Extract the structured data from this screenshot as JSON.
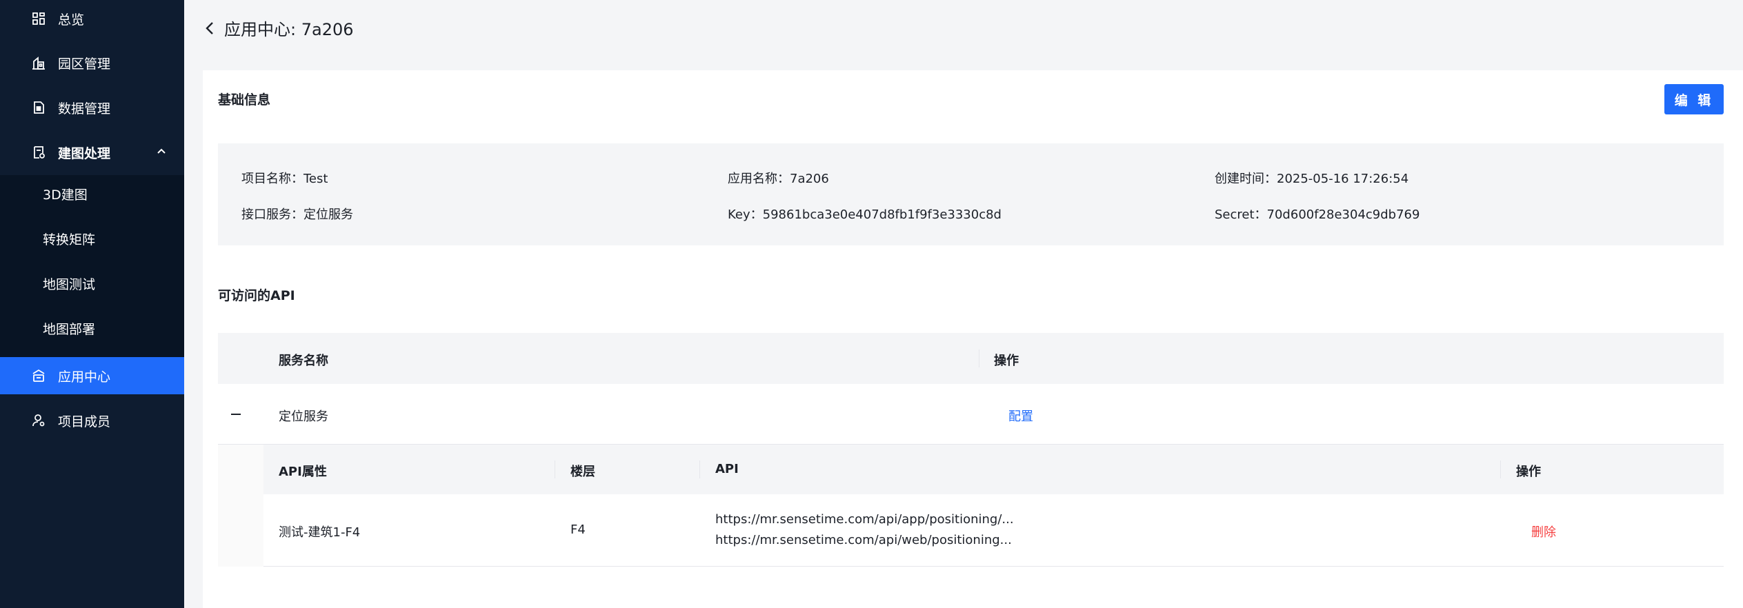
{
  "sidebar": {
    "items": [
      {
        "label": "总览",
        "icon": "dashboard-icon"
      },
      {
        "label": "园区管理",
        "icon": "building-icon"
      },
      {
        "label": "数据管理",
        "icon": "file-icon"
      },
      {
        "label": "建图处理",
        "icon": "map-process-icon",
        "expanded": true
      },
      {
        "label": "应用中心",
        "icon": "app-center-icon",
        "active": true
      },
      {
        "label": "项目成员",
        "icon": "member-icon"
      }
    ],
    "submenu": [
      {
        "label": "3D建图"
      },
      {
        "label": "转换矩阵"
      },
      {
        "label": "地图测试"
      },
      {
        "label": "地图部署"
      }
    ]
  },
  "header": {
    "title": "应用中心: 7a206"
  },
  "basic_info": {
    "title": "基础信息",
    "edit_label": "编 辑",
    "project_name": "项目名称：Test",
    "app_name": "应用名称：7a206",
    "created_time": "创建时间：2025-05-16 17:26:54",
    "api_service": "接口服务：定位服务",
    "key": "Key：59861bca3e0e407d8fb1f9f3e3330c8d",
    "secret": "Secret：70d600f28e304c9db769"
  },
  "api_section": {
    "title": "可访问的API",
    "columns": [
      "服务名称",
      "操作"
    ],
    "rows": [
      {
        "service": "定位服务",
        "action": "配置"
      }
    ],
    "sub_columns": [
      "API属性",
      "楼层",
      "API",
      "操作"
    ],
    "sub_rows": [
      {
        "attr": "测试-建筑1-F4",
        "floor": "F4",
        "api_1": "https://mr.sensetime.com/api/app/positioning/...",
        "api_2": "https://mr.sensetime.com/api/web/positioning...",
        "action": "删除"
      }
    ]
  },
  "colors": {
    "sidebar_bg": "#0e1c30",
    "accent": "#1f6bfa",
    "danger": "#f53f3f"
  }
}
